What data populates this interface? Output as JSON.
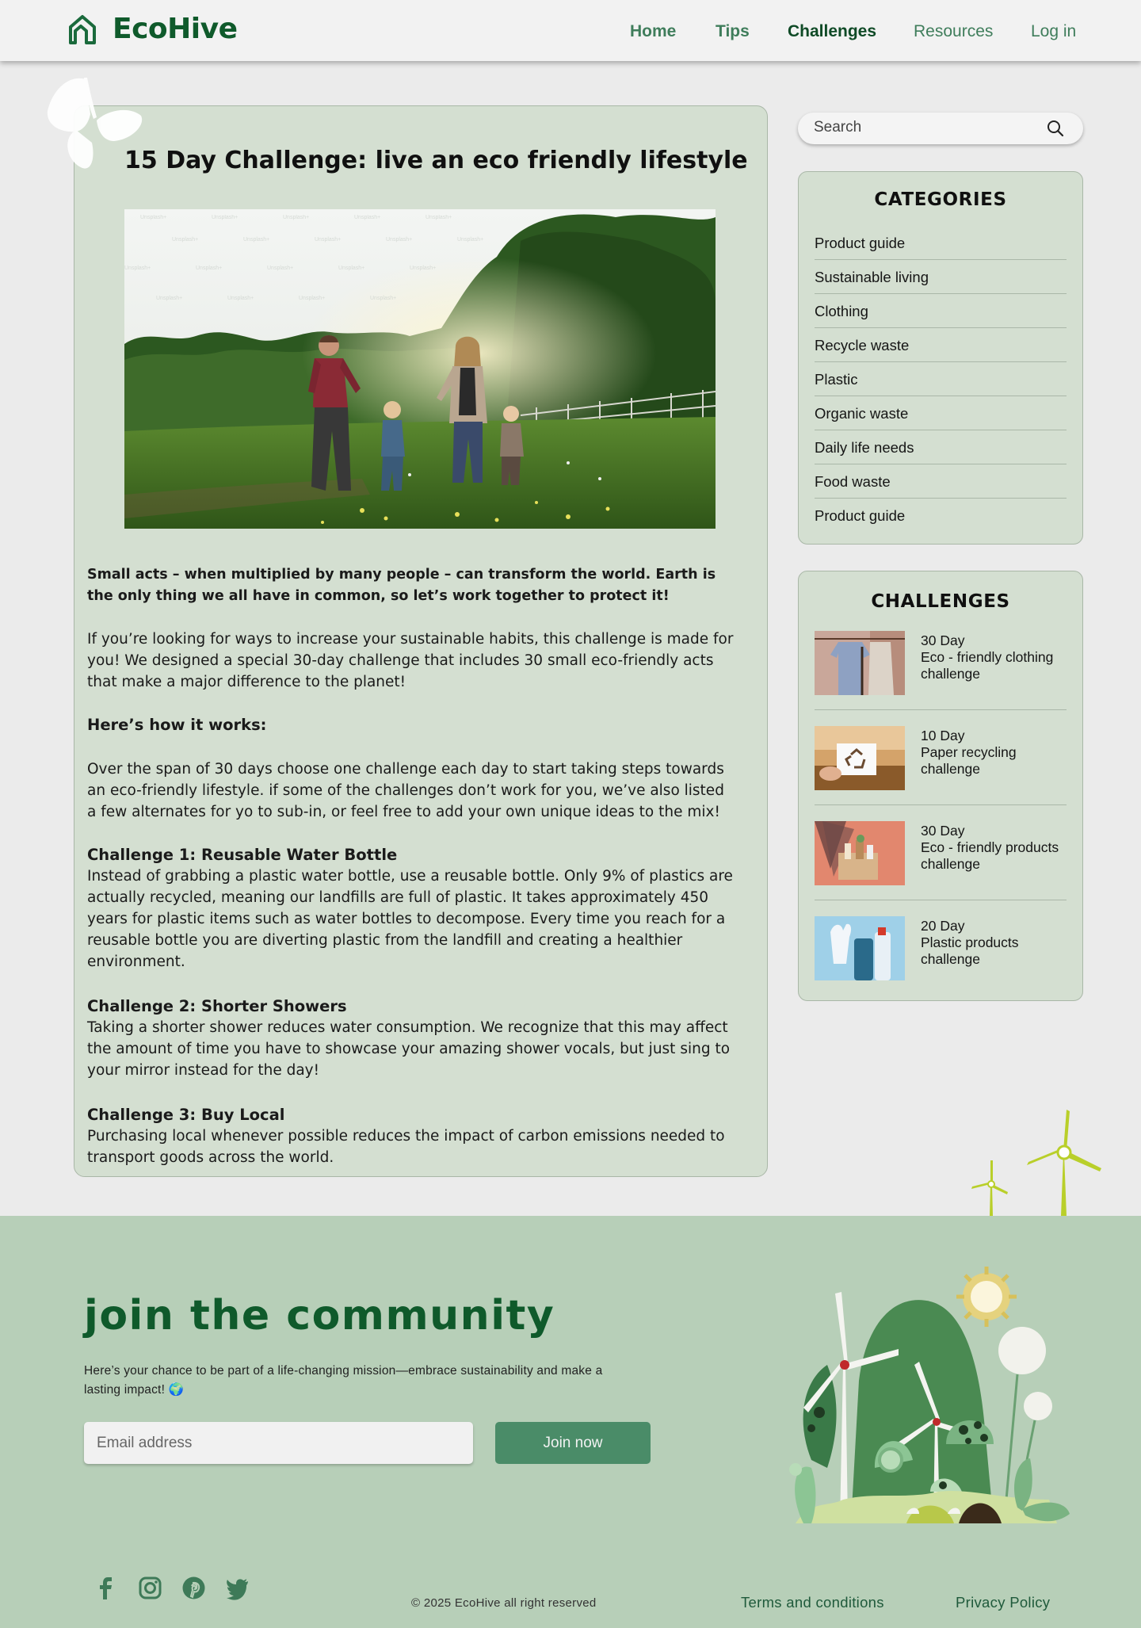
{
  "header": {
    "brand": "EcoHive",
    "nav": [
      {
        "label": "Home"
      },
      {
        "label": "Tips"
      },
      {
        "label": "Challenges"
      },
      {
        "label": "Resources"
      },
      {
        "label": "Log in"
      }
    ]
  },
  "article": {
    "title": "15 Day Challenge: live an eco friendly lifestyle",
    "lead": "Small acts – when multiplied by many people – can transform the world. Earth is the only thing we all have in common, so let’s work together to protect it!",
    "intro": "If you’re looking for ways to increase your sustainable habits, this challenge is made for you! We designed a special 30-day challenge that includes 30 small eco-friendly acts that make a major difference to the planet!",
    "how_heading": "Here’s how it works:",
    "how_text": "Over the span of 30 days choose one challenge each day to start taking steps towards an eco-friendly lifestyle. if some of the challenges don’t work for you, we’ve also listed a few alternates for yo to sub-in, or feel free to add your own unique ideas to the mix!",
    "challenges": [
      {
        "heading": "Challenge 1: Reusable Water Bottle",
        "text": "Instead of grabbing a plastic water bottle, use a reusable bottle. Only 9% of plastics are actually recycled, meaning our landfills are full of plastic. It takes approximately 450 years for plastic items such as water bottles to decompose. Every time you reach for a reusable bottle you are diverting plastic from the landfill and creating a healthier environment."
      },
      {
        "heading": "Challenge 2: Shorter Showers",
        "text": "Taking a shorter shower reduces water consumption. We recognize that this may affect the amount of time you have to showcase your amazing shower vocals, but just sing to your mirror instead for the day!"
      },
      {
        "heading": "Challenge 3: Buy Local",
        "text": "Purchasing local whenever possible reduces the impact of carbon emissions needed to transport goods across the world."
      }
    ]
  },
  "sidebar": {
    "search_placeholder": "Search",
    "categories_title": "CATEGORIES",
    "categories": [
      "Product guide",
      "Sustainable living",
      "Clothing",
      "Recycle waste",
      "Plastic",
      "Organic waste",
      "Daily life needs",
      "Food waste",
      "Product guide"
    ],
    "challenges_title": "CHALLENGES",
    "challenges": [
      {
        "days": "30 Day",
        "name": "Eco - friendly clothing",
        "suffix": "challenge"
      },
      {
        "days": "10 Day",
        "name": "Paper recycling",
        "suffix": "challenge"
      },
      {
        "days": "30 Day",
        "name": "Eco - friendly products",
        "suffix": "challenge"
      },
      {
        "days": "20 Day",
        "name": "Plastic products",
        "suffix": "challenge"
      }
    ]
  },
  "footer": {
    "heading": "join the community",
    "subtext": "Here’s your chance to be part of a life-changing mission—embrace sustainability and make a lasting impact! 🌍",
    "email_placeholder": "Email address",
    "join_label": "Join now",
    "copyright": "© 2025 EcoHive all right reserved",
    "terms": "Terms and conditions",
    "privacy": "Privacy Policy",
    "socials": [
      "facebook-icon",
      "instagram-icon",
      "pinterest-icon",
      "twitter-icon"
    ]
  },
  "colors": {
    "brand": "#0f5a2b",
    "card": "#d4dfd1",
    "footer": "#b7cfb8",
    "button": "#4a8c68"
  }
}
